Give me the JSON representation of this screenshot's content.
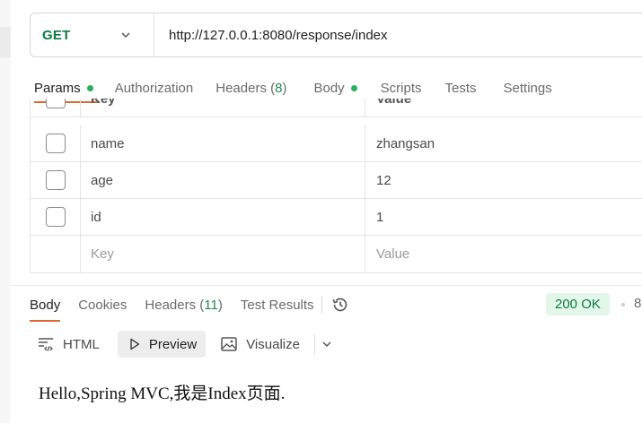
{
  "request": {
    "method": "GET",
    "url": "http://127.0.0.1:8080/response/index",
    "method_color": "#0c7a43"
  },
  "request_tabs": [
    {
      "label": "Params",
      "active": true,
      "dot": true
    },
    {
      "label": "Authorization"
    },
    {
      "label": "Headers",
      "count": "8"
    },
    {
      "label": "Body",
      "dot": true
    },
    {
      "label": "Scripts"
    },
    {
      "label": "Tests"
    },
    {
      "label": "Settings"
    }
  ],
  "params": {
    "headers": {
      "key": "Key",
      "value": "Value"
    },
    "rows": [
      {
        "key": "name",
        "value": "zhangsan"
      },
      {
        "key": "age",
        "value": "12"
      },
      {
        "key": "id",
        "value": "1"
      }
    ],
    "new_row": {
      "key_placeholder": "Key",
      "value_placeholder": "Value"
    }
  },
  "response_tabs": [
    {
      "label": "Body",
      "active": true
    },
    {
      "label": "Cookies"
    },
    {
      "label": "Headers",
      "count": "11"
    },
    {
      "label": "Test Results"
    }
  ],
  "status": {
    "text": "200 OK",
    "truncated": "8"
  },
  "format_bar": {
    "html_label": "HTML",
    "preview_label": "Preview",
    "visualize_label": "Visualize"
  },
  "response_body": "Hello,Spring MVC,我是Index页面.",
  "colors": {
    "accent": "#e0662e",
    "success": "#26b25c",
    "status_bg": "#e3f6ea"
  }
}
